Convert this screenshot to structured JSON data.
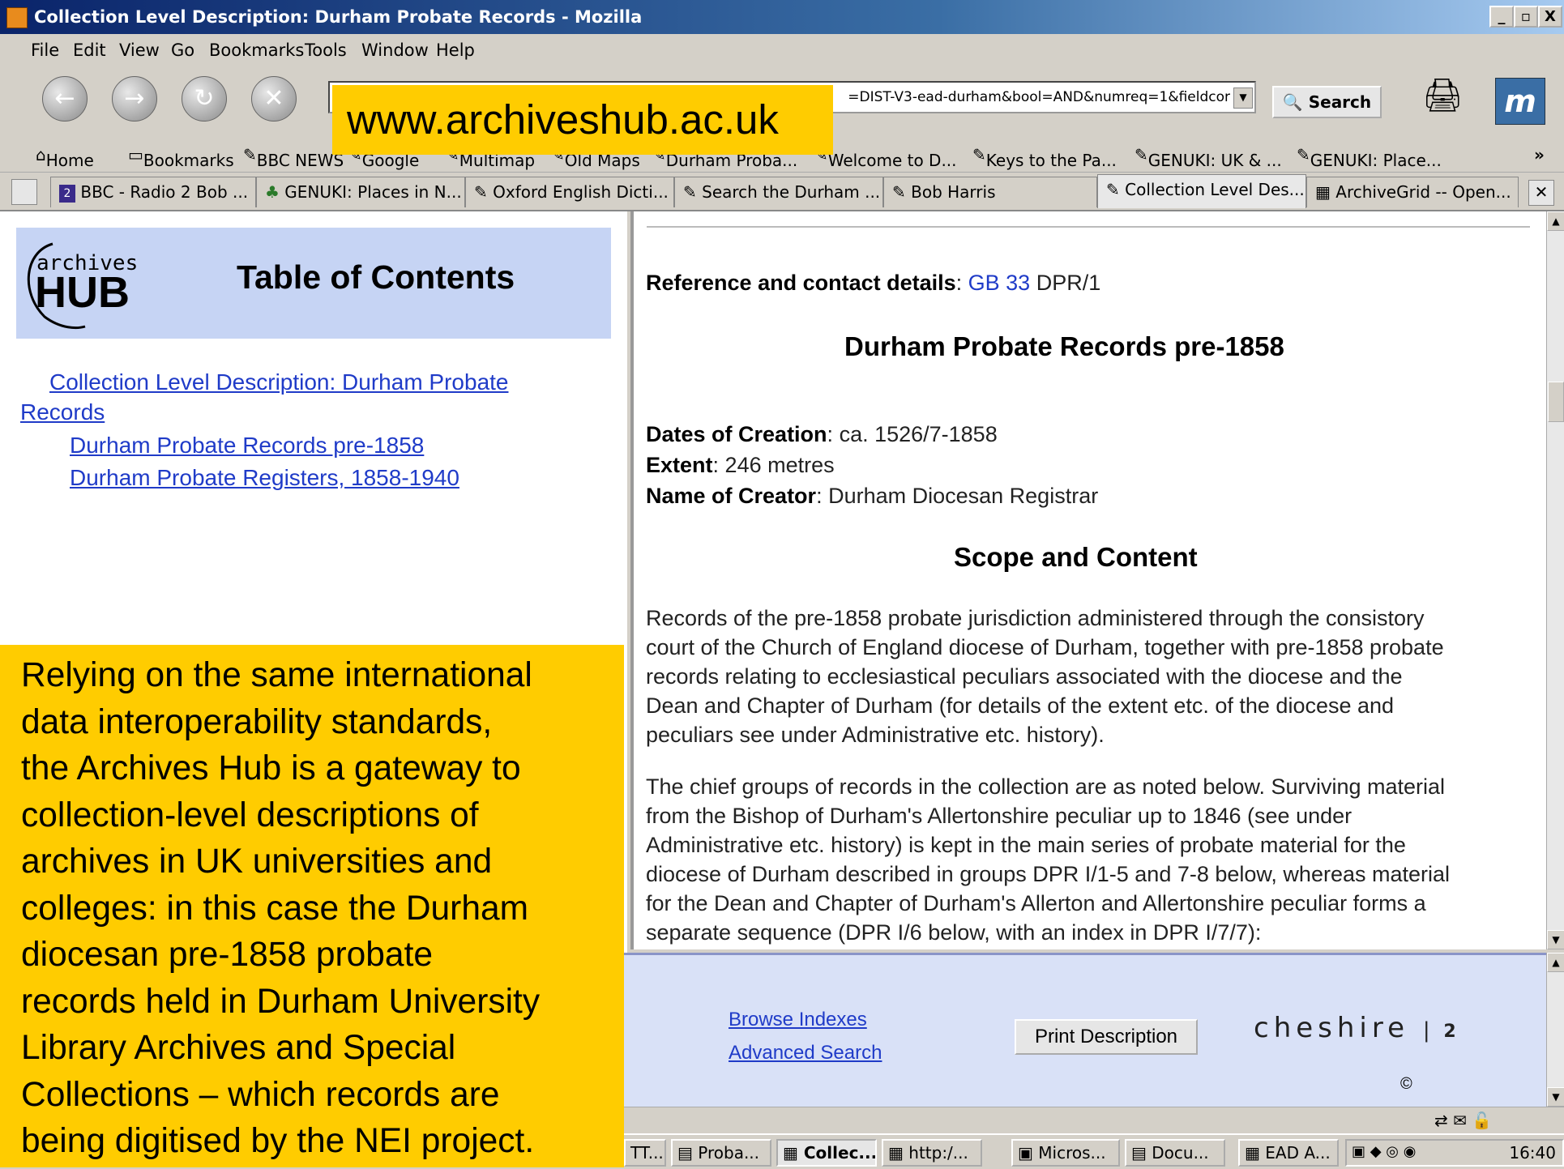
{
  "window": {
    "title": "Collection Level Description: Durham Probate Records - Mozilla",
    "minimize": "_",
    "maximize": "▫",
    "close": "X"
  },
  "menu": [
    "File",
    "Edit",
    "View",
    "Go",
    "Bookmarks",
    "Tools",
    "Window",
    "Help"
  ],
  "navbar": {
    "url_value": "=DIST-V3-ead-durham&bool=AND&numreq=1&fieldcor",
    "search_label": "Search",
    "throbber_label": "m"
  },
  "overlay_url": "www.archiveshub.ac.uk",
  "bookmarks": [
    "Home",
    "Bookmarks",
    "BBC NEWS",
    "Google",
    "Multimap",
    "Old Maps",
    "Durham Proba...",
    "Welcome to D...",
    "Keys to the Pa...",
    "GENUKI: UK & ...",
    "GENUKI: Place...",
    "»"
  ],
  "tabs": [
    "BBC - Radio 2 Bob ...",
    "GENUKI: Places in N...",
    "Oxford English Dicti...",
    "Search the Durham ...",
    "Bob Harris",
    "Collection Level Des...",
    "ArchiveGrid -- Open..."
  ],
  "toc": {
    "logo_top": "archives",
    "logo_bottom": "HUB",
    "title": "Table of Contents",
    "link_main_line1": "Collection Level Description: Durham Probate",
    "link_main_line2": "Records",
    "link_sub1": "Durham Probate Records pre-1858",
    "link_sub2": "Durham Probate Registers, 1858-1940"
  },
  "overlay_desc": [
    "Relying on the same international",
    "data interoperability standards,",
    "the Archives Hub is a gateway to",
    "collection-level descriptions of",
    "archives in UK universities and",
    "colleges: in this case the Durham",
    "diocesan pre-1858 probate",
    "records held in Durham University",
    "Library Archives and Special",
    "Collections – which records are",
    "being digitised by the NEI project."
  ],
  "record": {
    "ref_label": "Reference and contact details",
    "ref_link": "GB 33",
    "ref_value": "DPR/1",
    "title": "Durham Probate Records pre-1858",
    "dates_label": "Dates of Creation",
    "dates_value": "ca. 1526/7-1858",
    "extent_label": "Extent",
    "extent_value": "246 metres",
    "creator_label": "Name of Creator",
    "creator_value": "Durham Diocesan Registrar",
    "scope_heading": "Scope and Content",
    "para1": [
      "Records of the pre-1858 probate jurisdiction administered through the consistory",
      "court of the Church of England diocese of Durham, together with pre-1858 probate",
      "records relating to ecclesiastical peculiars associated with the diocese and the",
      "Dean and Chapter of Durham (for details of the extent etc. of the diocese and",
      "peculiars see under Administrative etc. history)."
    ],
    "para2": [
      "The chief groups of records in the collection are as noted below. Surviving material",
      "from the Bishop of Durham's Allertonshire peculiar up to 1846 (see under",
      "Administrative etc. history) is kept in the main series of probate material for the",
      "diocese of Durham described in groups DPR I/1-5 and 7-8 below, whereas material",
      "for the Dean and Chapter of Durham's Allerton and Allertonshire peculiar forms a",
      "separate sequence (DPR I/6 below, with an index in DPR I/7/7):"
    ]
  },
  "bottom": {
    "browse": "Browse Indexes",
    "advanced": "Advanced Search",
    "print": "Print Description",
    "cheshire": "cheshire",
    "cheshire_ver": "2",
    "copyright": "©"
  },
  "taskbar": {
    "tasks": [
      "TT...",
      "Proba...",
      "Collec...",
      "http:/...",
      "Micros...",
      "Docu...",
      "EAD A..."
    ],
    "clock": "16:40"
  }
}
